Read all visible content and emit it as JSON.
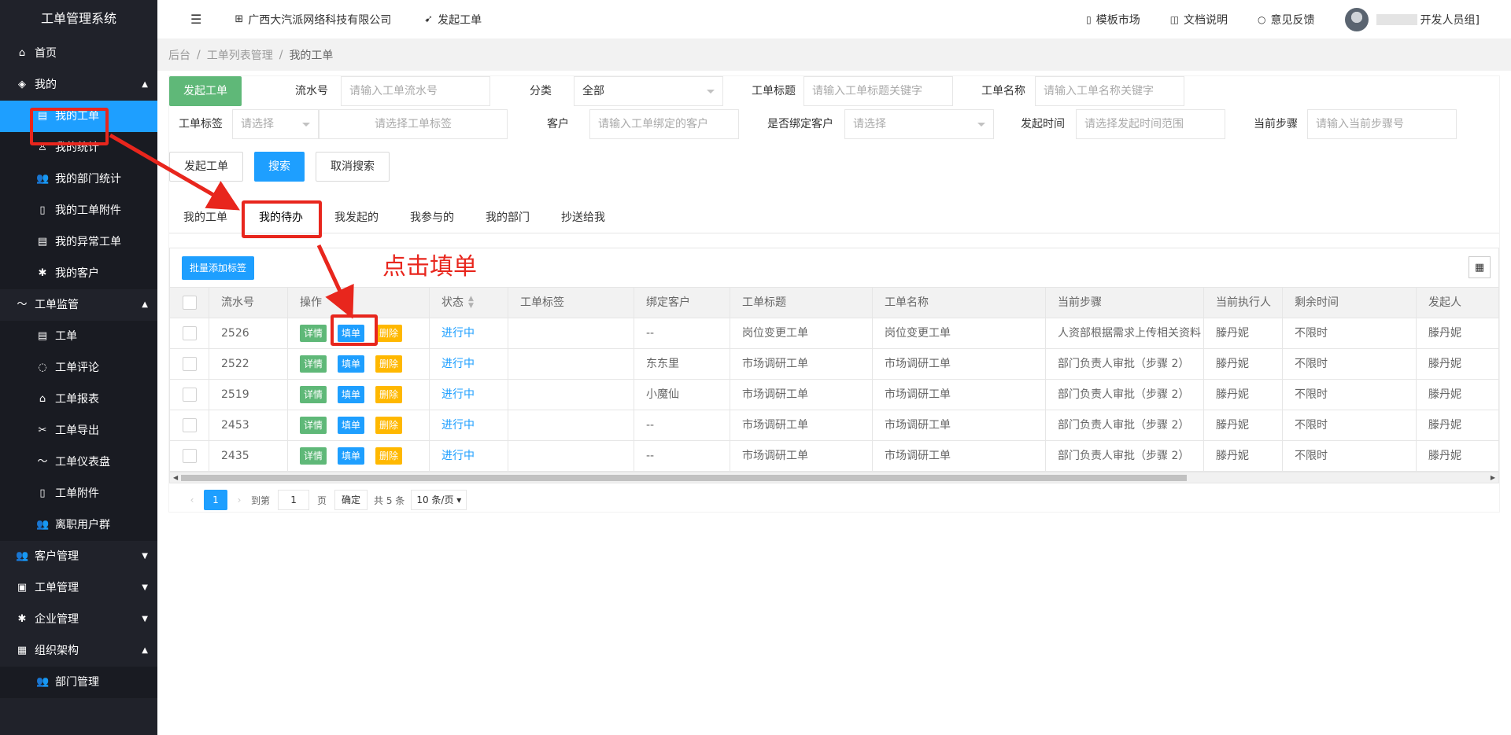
{
  "sidebar": {
    "title": "工单管理系统",
    "items": [
      {
        "label": "首页",
        "icon": "home-icon"
      },
      {
        "label": "我的",
        "icon": "layers-icon"
      },
      {
        "label": "我的工单",
        "icon": "doc-icon"
      },
      {
        "label": "我的统计",
        "icon": "user-icon"
      },
      {
        "label": "我的部门统计",
        "icon": "users-icon"
      },
      {
        "label": "我的工单附件",
        "icon": "file-icon"
      },
      {
        "label": "我的异常工单",
        "icon": "doc-icon"
      },
      {
        "label": "我的客户",
        "icon": "gear-icon"
      },
      {
        "label": "工单监管",
        "icon": "pulse-icon"
      },
      {
        "label": "工单",
        "icon": "doc-icon"
      },
      {
        "label": "工单评论",
        "icon": "comment-icon"
      },
      {
        "label": "工单报表",
        "icon": "home-icon"
      },
      {
        "label": "工单导出",
        "icon": "export-icon"
      },
      {
        "label": "工单仪表盘",
        "icon": "pulse-icon"
      },
      {
        "label": "工单附件",
        "icon": "file-icon"
      },
      {
        "label": "离职用户群",
        "icon": "users-icon"
      },
      {
        "label": "客户管理",
        "icon": "users-icon"
      },
      {
        "label": "工单管理",
        "icon": "clipboard-icon"
      },
      {
        "label": "企业管理",
        "icon": "gear-icon"
      },
      {
        "label": "组织架构",
        "icon": "calendar-icon"
      },
      {
        "label": "部门管理",
        "icon": "users-icon"
      }
    ]
  },
  "topbar": {
    "company": "广西大汽派网络科技有限公司",
    "create_ticket": "发起工单",
    "template_market": "模板市场",
    "docs": "文档说明",
    "feedback": "意见反馈",
    "user_suffix": "开发人员组]"
  },
  "breadcrumb": [
    "后台",
    "/",
    "工单列表管理",
    "/",
    "我的工单"
  ],
  "filters": {
    "create_btn": "发起工单",
    "serial_label": "流水号",
    "serial_placeholder": "请输入工单流水号",
    "category_label": "分类",
    "category_value": "全部",
    "title_label": "工单标题",
    "title_placeholder": "请输入工单标题关键字",
    "name_label": "工单名称",
    "name_placeholder": "请输入工单名称关键字",
    "tag_label": "工单标签",
    "tag_select": "请选择",
    "tag_placeholder": "请选择工单标签",
    "customer_label": "客户",
    "customer_placeholder": "请输入工单绑定的客户",
    "bind_label": "是否绑定客户",
    "bind_select": "请选择",
    "time_label": "发起时间",
    "time_placeholder": "请选择发起时间范围",
    "step_label": "当前步骤",
    "step_placeholder": "请输入当前步骤号",
    "create_btn2": "发起工单",
    "search_btn": "搜索",
    "cancel_btn": "取消搜索"
  },
  "tabs": [
    "我的工单",
    "我的待办",
    "我发起的",
    "我参与的",
    "我的部门",
    "抄送给我"
  ],
  "table": {
    "batch_btn": "批量添加标签",
    "headers": [
      "流水号",
      "操作",
      "状态",
      "工单标签",
      "绑定客户",
      "工单标题",
      "工单名称",
      "当前步骤",
      "当前执行人",
      "剩余时间",
      "发起人"
    ],
    "actions": {
      "detail": "详情",
      "fill": "填单",
      "delete": "删除"
    },
    "rows": [
      {
        "id": "2526",
        "status": "进行中",
        "tag": "",
        "customer": "--",
        "title": "岗位变更工单",
        "name": "岗位变更工单",
        "step": "人资部根据需求上传相关资料",
        "executor": "滕丹妮",
        "remain": "不限时",
        "initiator": "滕丹妮"
      },
      {
        "id": "2522",
        "status": "进行中",
        "tag": "",
        "customer": "东东里",
        "title": "市场调研工单",
        "name": "市场调研工单",
        "step": "部门负责人审批（步骤 2）",
        "executor": "滕丹妮",
        "remain": "不限时",
        "initiator": "滕丹妮"
      },
      {
        "id": "2519",
        "status": "进行中",
        "tag": "",
        "customer": "小魔仙",
        "title": "市场调研工单",
        "name": "市场调研工单",
        "step": "部门负责人审批（步骤 2）",
        "executor": "滕丹妮",
        "remain": "不限时",
        "initiator": "滕丹妮"
      },
      {
        "id": "2453",
        "status": "进行中",
        "tag": "",
        "customer": "--",
        "title": "市场调研工单",
        "name": "市场调研工单",
        "step": "部门负责人审批（步骤 2）",
        "executor": "滕丹妮",
        "remain": "不限时",
        "initiator": "滕丹妮"
      },
      {
        "id": "2435",
        "status": "进行中",
        "tag": "",
        "customer": "--",
        "title": "市场调研工单",
        "name": "市场调研工单",
        "step": "部门负责人审批（步骤 2）",
        "executor": "滕丹妮",
        "remain": "不限时",
        "initiator": "滕丹妮"
      }
    ]
  },
  "pager": {
    "current": "1",
    "goto_label": "到第",
    "goto_value": "1",
    "page_label": "页",
    "ok": "确定",
    "total": "共 5 条",
    "limit": "10 条/页"
  },
  "annotation": {
    "text": "点击填单",
    "color": "#e8261d"
  },
  "colors": {
    "sidebar_bg": "#20222a",
    "accent": "#1e9fff",
    "green": "#5fb878",
    "orange": "#ffb800"
  }
}
